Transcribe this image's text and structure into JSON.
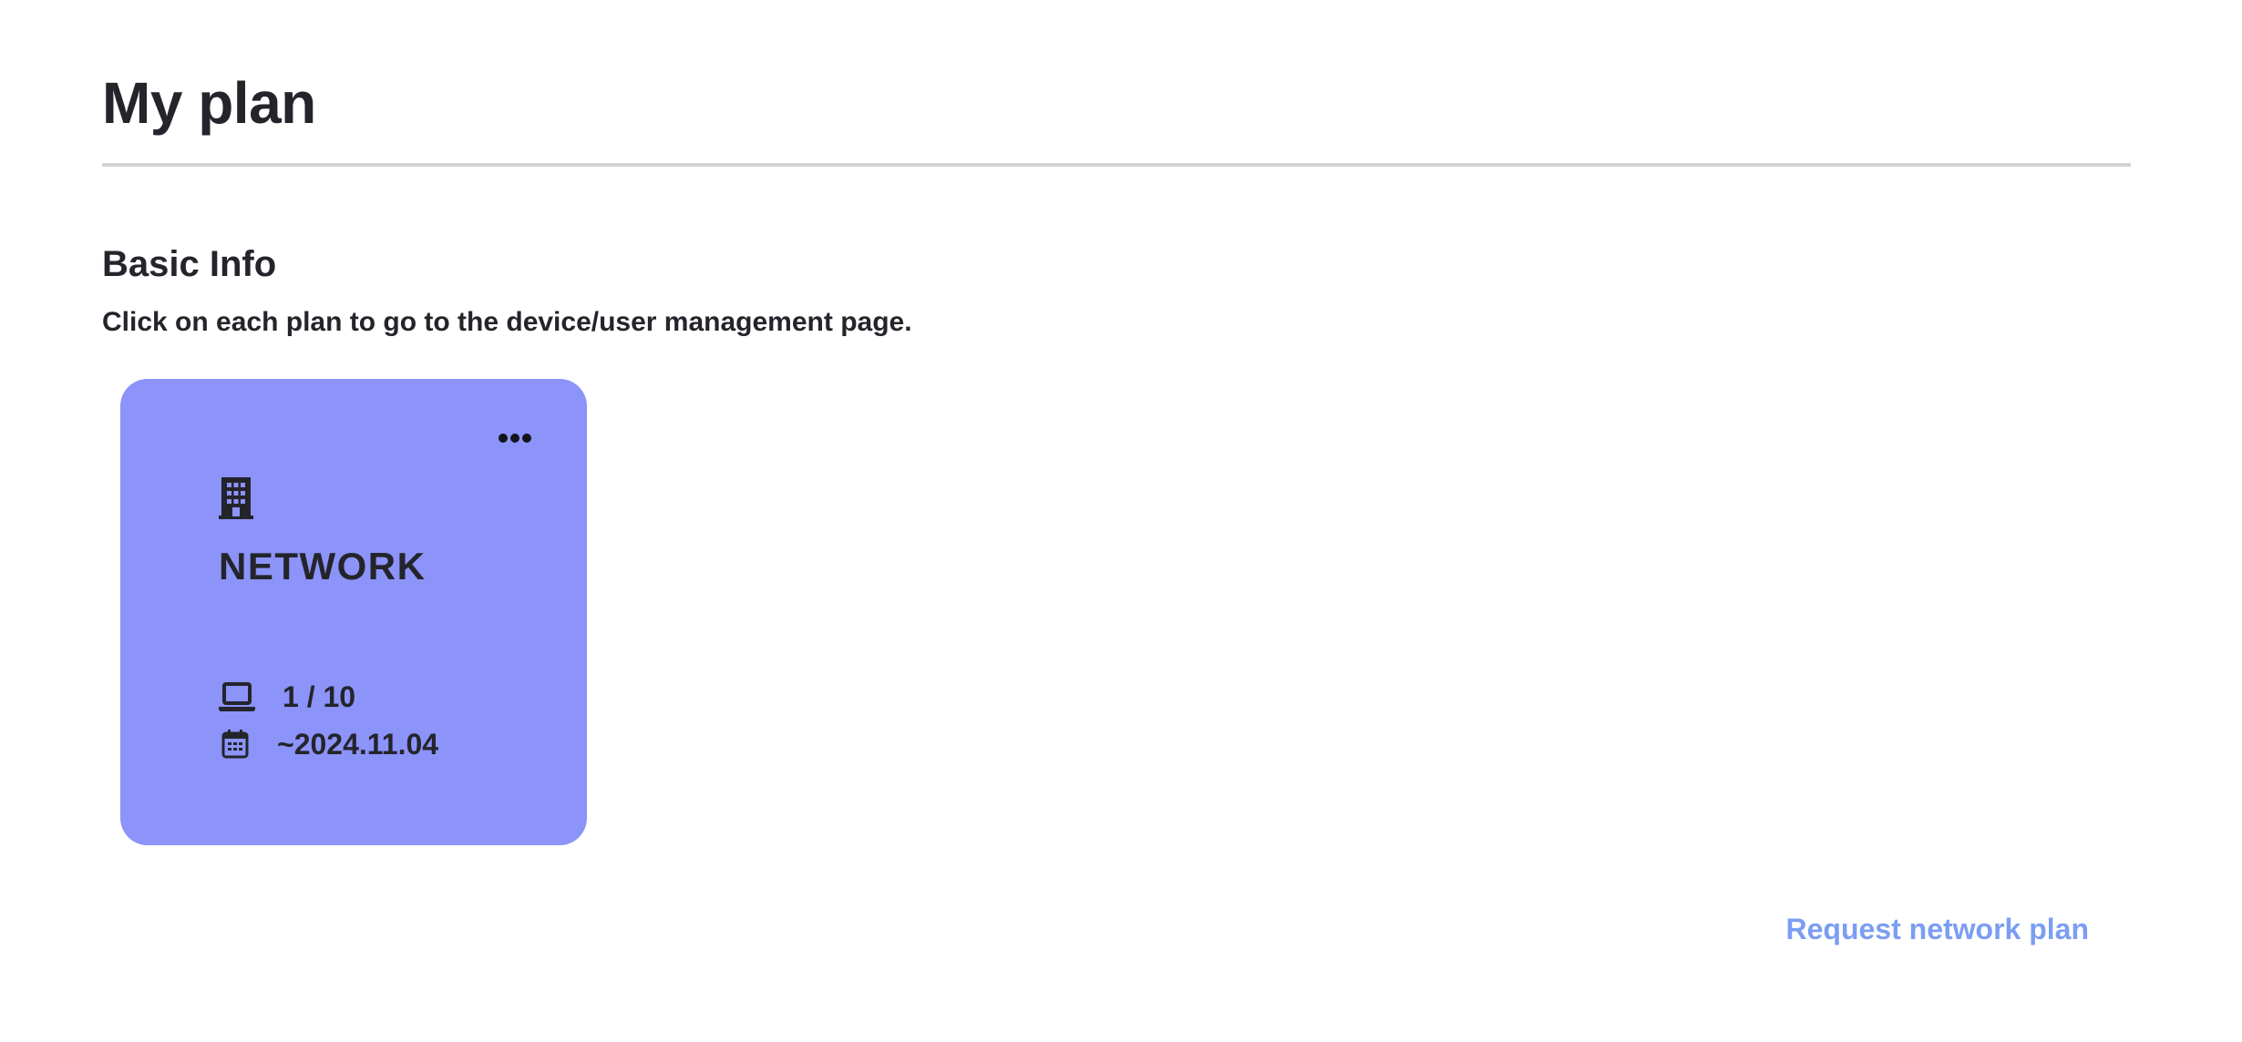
{
  "page": {
    "title": "My plan"
  },
  "basic_info": {
    "heading": "Basic Info",
    "description": "Click on each plan to go to the device/user management page."
  },
  "plans": [
    {
      "name": "NETWORK",
      "icon": "building-icon",
      "devices_label": "1 / 10",
      "devices_used": 1,
      "devices_limit": 10,
      "devices_icon": "laptop-icon",
      "expiry_label": "~2024.11.04",
      "expiry_icon": "calendar-icon",
      "menu_icon": "more-horizontal-icon",
      "card_color": "#8c93f9"
    }
  ],
  "actions": {
    "request_plan_label": "Request network plan"
  },
  "colors": {
    "text": "#23252b",
    "divider": "#d2d2d4",
    "link": "#7b9ef3",
    "card": "#8c93f9",
    "background": "#ffffff"
  }
}
